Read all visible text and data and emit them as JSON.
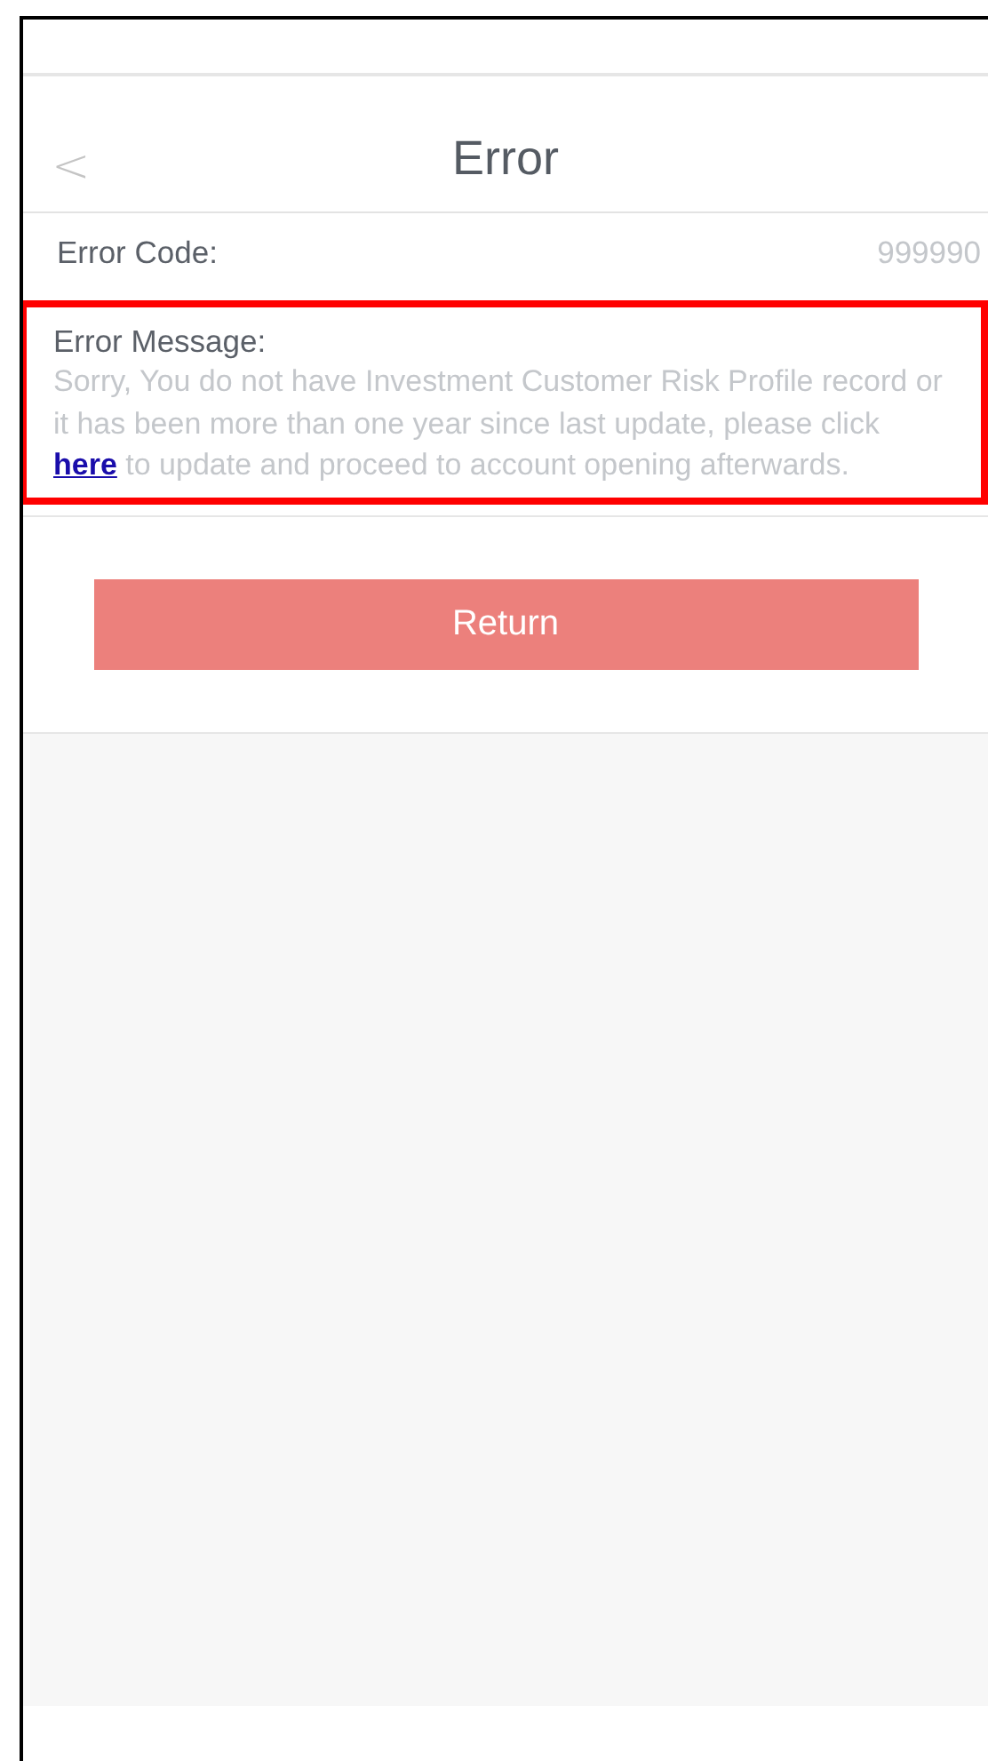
{
  "nav": {
    "title": "Error",
    "back": "<"
  },
  "error_code": {
    "label": "Error Code:",
    "value": "999990"
  },
  "error_message": {
    "label": "Error Message:",
    "highlighted": true,
    "text_before": "Sorry, You do not have Investment Customer Risk Profile record or it has been more than one year since last update, please click",
    "link": "here",
    "text_after": "to update and proceed to account opening afterwards."
  },
  "buttons": [
    {
      "label": "Return"
    }
  ]
}
